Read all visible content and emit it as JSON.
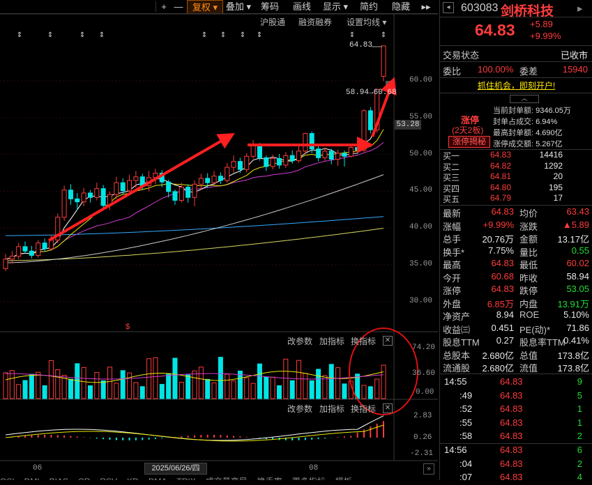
{
  "toolbar": {
    "plus": "+",
    "minus": "—",
    "fuquan": "复权",
    "diejia": "叠加",
    "chouma": "筹码",
    "huaxian": "画线",
    "xianshi": "显示",
    "jianyue": "简约",
    "yincang": "隐藏"
  },
  "subbar": {
    "hugutong": "沪股通",
    "rongzi": "融资融券",
    "setma": "设置均线"
  },
  "price_axis": [
    "60.00",
    "55.00",
    "50.00",
    "45.00",
    "40.00",
    "35.00",
    "30.00"
  ],
  "current_price_tag": "53.28",
  "annotations": {
    "high": "64.83",
    "range": "58.94→60.68"
  },
  "volume_panel": {
    "btn_params": "改参数",
    "btn_add": "加指标",
    "btn_switch": "换指标",
    "axis": [
      "74.20",
      "36.60",
      "0.00"
    ]
  },
  "macd_panel": {
    "btn_params": "改参数",
    "btn_add": "加指标",
    "btn_switch": "换指标",
    "axis": [
      "2.83",
      "0.26",
      "-2.31"
    ]
  },
  "time_axis": {
    "left": "06",
    "mid": "2025/06/26/四",
    "right": "08"
  },
  "bottom_tabs": [
    "OSI",
    "DMI",
    "BIAS",
    "CR",
    "RSV",
    "KD",
    "DMA",
    "TRIX",
    "成交量变异",
    "换手率",
    "更多指标",
    "模板"
  ],
  "stock": {
    "code": "603083",
    "name": "剑桥科技",
    "price": "64.83",
    "change": "+5.89",
    "pct": "+9.99%"
  },
  "status": {
    "label": "交易状态",
    "value": "已收市"
  },
  "weibi": {
    "label1": "委比",
    "value1": "100.00%",
    "label2": "委差",
    "value2": "15940"
  },
  "promo": "抓住机会，即刻开户!",
  "limit": {
    "title": "涨停",
    "sub": "(2天2板)",
    "btn": "涨停揭秘",
    "rows": [
      {
        "k": "当前封单额:",
        "v": "9346.05万"
      },
      {
        "k": "封单占成交:",
        "v": "6.94%"
      },
      {
        "k": "最高封单额:",
        "v": "4.690亿"
      },
      {
        "k": "涨停成交额:",
        "v": "5.267亿"
      }
    ]
  },
  "bids": [
    {
      "label": "买一",
      "price": "64.83",
      "vol": "14416"
    },
    {
      "label": "买二",
      "price": "64.82",
      "vol": "1292"
    },
    {
      "label": "买三",
      "price": "64.81",
      "vol": "20"
    },
    {
      "label": "买四",
      "price": "64.80",
      "vol": "195"
    },
    {
      "label": "买五",
      "price": "64.79",
      "vol": "17"
    }
  ],
  "stats": [
    {
      "k1": "最新",
      "v1": "64.83",
      "c1": "red",
      "k2": "均价",
      "v2": "63.43",
      "c2": "red"
    },
    {
      "k1": "涨幅",
      "v1": "+9.99%",
      "c1": "red",
      "k2": "涨跌",
      "v2": "▲5.89",
      "c2": "red"
    },
    {
      "k1": "总手",
      "v1": "20.76万",
      "c1": "white",
      "k2": "金额",
      "v2": "13.17亿",
      "c2": "white"
    },
    {
      "k1": "换手*",
      "v1": "7.75%",
      "c1": "white",
      "k2": "量比",
      "v2": "0.55",
      "c2": "green"
    },
    {
      "k1": "最高",
      "v1": "64.83",
      "c1": "red",
      "k2": "最低",
      "v2": "60.02",
      "c2": "red"
    },
    {
      "k1": "今开",
      "v1": "60.68",
      "c1": "red",
      "k2": "昨收",
      "v2": "58.94",
      "c2": "white"
    },
    {
      "k1": "涨停",
      "v1": "64.83",
      "c1": "red",
      "k2": "跌停",
      "v2": "53.05",
      "c2": "green"
    },
    {
      "k1": "外盘",
      "v1": "6.85万",
      "c1": "red",
      "k2": "内盘",
      "v2": "13.91万",
      "c2": "green"
    },
    {
      "k1": "净资产",
      "v1": "8.94",
      "c1": "white",
      "k2": "ROE",
      "v2": "5.10%",
      "c2": "white"
    },
    {
      "k1": "收益㈢",
      "v1": "0.451",
      "c1": "white",
      "k2": "PE(动)*",
      "v2": "71.86",
      "c2": "white"
    },
    {
      "k1": "股息TTM",
      "v1": "0.27",
      "c1": "white",
      "k2": "股息率TTM",
      "v2": "0.41%",
      "c2": "white"
    },
    {
      "k1": "总股本",
      "v1": "2.680亿",
      "c1": "white",
      "k2": "总值",
      "v2": "173.8亿",
      "c2": "white"
    },
    {
      "k1": "流通股",
      "v1": "2.680亿",
      "c1": "white",
      "k2": "流值",
      "v2": "173.8亿",
      "c2": "white"
    }
  ],
  "ticks": [
    {
      "t": "14:55",
      "p": "64.83",
      "v": "9",
      "vc": "green"
    },
    {
      "t": ":49",
      "p": "64.83",
      "v": "5",
      "vc": "green"
    },
    {
      "t": ":52",
      "p": "64.83",
      "v": "1",
      "vc": "green"
    },
    {
      "t": ":55",
      "p": "64.83",
      "v": "1",
      "vc": "green"
    },
    {
      "t": ":58",
      "p": "64.83",
      "v": "2",
      "vc": "green"
    },
    {
      "t": "14:56",
      "p": "64.83",
      "v": "6",
      "vc": "green"
    },
    {
      "t": ":04",
      "p": "64.83",
      "v": "2",
      "vc": "green"
    },
    {
      "t": ":07",
      "p": "64.83",
      "v": "4",
      "vc": "green"
    }
  ],
  "chart_data": {
    "type": "candlestick",
    "ylim": [
      30,
      65
    ],
    "candles": [
      [
        34.5,
        35.8,
        34.2,
        36.5
      ],
      [
        35.8,
        36.2,
        35.2,
        36.9
      ],
      [
        36.2,
        37.5,
        35.8,
        38.0
      ],
      [
        37.5,
        36.9,
        36.5,
        38.2
      ],
      [
        36.9,
        36.3,
        35.9,
        37.6
      ],
      [
        36.3,
        38.0,
        36.0,
        38.4
      ],
      [
        38.0,
        37.2,
        36.8,
        38.6
      ],
      [
        37.2,
        38.4,
        37.0,
        39.1
      ],
      [
        38.4,
        41.5,
        38.0,
        42.0
      ],
      [
        41.5,
        45.2,
        41.0,
        45.8
      ],
      [
        45.2,
        44.0,
        43.2,
        46.0
      ],
      [
        44.0,
        43.6,
        42.5,
        44.8
      ],
      [
        43.6,
        44.8,
        43.0,
        45.5
      ],
      [
        44.8,
        44.2,
        43.5,
        45.2
      ],
      [
        44.2,
        45.4,
        43.8,
        46.2
      ],
      [
        45.4,
        43.1,
        42.7,
        45.9
      ],
      [
        43.1,
        44.6,
        42.5,
        45.0
      ],
      [
        44.6,
        46.2,
        44.0,
        47.0
      ],
      [
        46.2,
        45.1,
        44.6,
        46.8
      ],
      [
        45.1,
        46.5,
        44.6,
        47.3
      ],
      [
        46.5,
        47.0,
        45.5,
        47.8
      ],
      [
        47.0,
        45.8,
        45.2,
        47.4
      ],
      [
        45.8,
        46.9,
        45.0,
        47.8
      ],
      [
        46.9,
        47.5,
        46.0,
        48.1
      ],
      [
        47.5,
        46.3,
        45.6,
        47.9
      ],
      [
        46.3,
        45.0,
        44.2,
        46.6
      ],
      [
        45.0,
        43.8,
        43.2,
        45.3
      ],
      [
        43.8,
        45.6,
        43.5,
        46.2
      ],
      [
        45.6,
        44.2,
        43.5,
        46.0
      ],
      [
        44.2,
        46.0,
        43.0,
        46.5
      ],
      [
        46.0,
        46.8,
        45.2,
        47.4
      ],
      [
        46.8,
        46.2,
        45.5,
        47.5
      ],
      [
        46.2,
        47.1,
        45.9,
        47.8
      ],
      [
        47.1,
        46.5,
        46.0,
        47.6
      ],
      [
        46.5,
        48.3,
        46.2,
        48.9
      ],
      [
        48.3,
        49.1,
        47.6,
        49.9
      ],
      [
        49.1,
        48.0,
        47.5,
        49.6
      ],
      [
        48.0,
        49.8,
        47.6,
        50.2
      ],
      [
        49.8,
        51.2,
        49.5,
        52.0
      ],
      [
        51.2,
        49.6,
        49.2,
        51.6
      ],
      [
        49.6,
        48.4,
        47.8,
        49.9
      ],
      [
        48.4,
        49.5,
        48.0,
        50.0
      ],
      [
        49.5,
        48.6,
        48.1,
        50.1
      ],
      [
        48.6,
        49.9,
        48.2,
        50.4
      ],
      [
        49.9,
        49.2,
        48.8,
        50.6
      ],
      [
        49.2,
        50.5,
        48.9,
        51.2
      ],
      [
        50.5,
        52.9,
        50.1,
        53.0
      ],
      [
        52.9,
        50.8,
        50.2,
        53.2
      ],
      [
        50.8,
        49.6,
        49.1,
        51.3
      ],
      [
        49.6,
        50.5,
        49.2,
        51.0
      ],
      [
        50.5,
        49.4,
        48.7,
        50.8
      ],
      [
        49.4,
        50.2,
        48.5,
        50.7
      ],
      [
        50.2,
        49.8,
        48.4,
        50.6
      ],
      [
        49.8,
        51.0,
        49.6,
        51.4
      ],
      [
        51.0,
        50.6,
        50.1,
        51.3
      ],
      [
        50.6,
        56.0,
        50.4,
        56.2
      ],
      [
        56.0,
        53.4,
        52.9,
        56.5
      ],
      [
        53.4,
        58.9,
        53.0,
        58.94
      ],
      [
        60.68,
        64.83,
        60.02,
        64.83
      ]
    ]
  }
}
